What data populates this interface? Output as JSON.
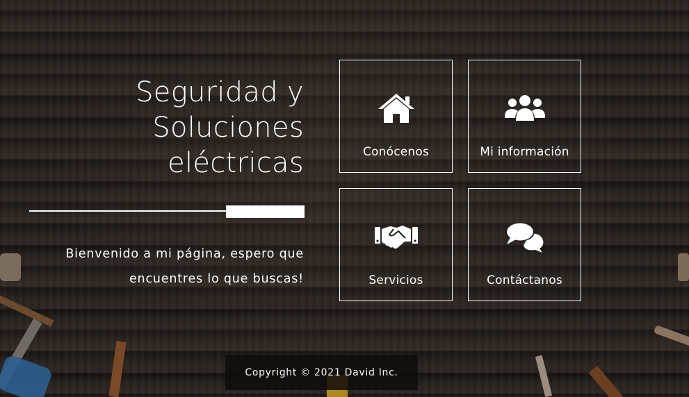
{
  "hero": {
    "title_line1": "Seguridad y",
    "title_line2": "Soluciones",
    "title_line3": "eléctricas",
    "welcome_line1": "Bienvenido a mi página, espero que",
    "welcome_line2": "encuentres lo que buscas!"
  },
  "menu": {
    "tiles": [
      {
        "label": "Conócenos",
        "icon": "home-icon"
      },
      {
        "label": "Mi información",
        "icon": "users-icon"
      },
      {
        "label": "Servicios",
        "icon": "handshake-icon"
      },
      {
        "label": "Contáctanos",
        "icon": "comments-icon"
      }
    ]
  },
  "footer": {
    "copyright": "Copyright © 2021 David Inc."
  },
  "colors": {
    "background": "#231d19",
    "foreground": "#ffffff",
    "footer_bg": "#0f0c0a"
  }
}
